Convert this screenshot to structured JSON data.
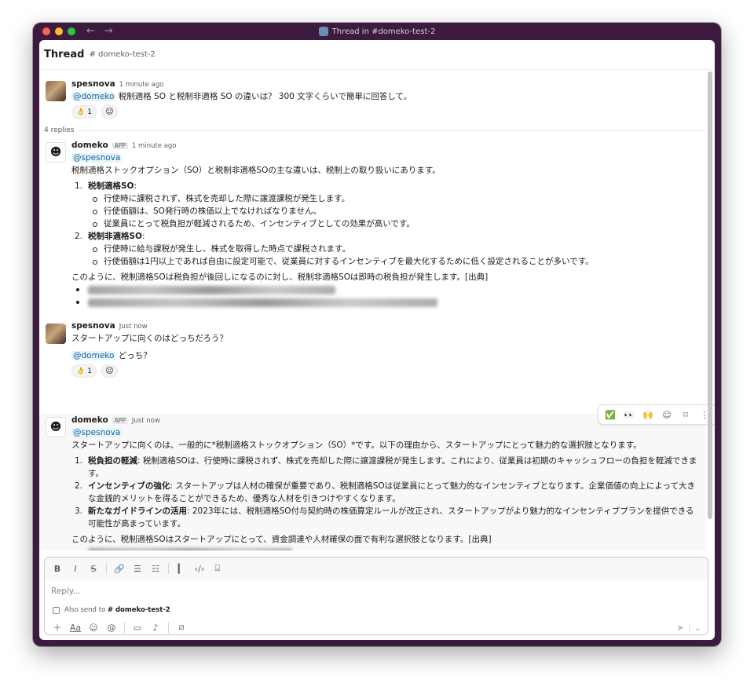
{
  "window": {
    "title": "Thread in #domeko-test-2",
    "back": "←",
    "forward": "→"
  },
  "header": {
    "title": "Thread",
    "channel": "# domeko-test-2"
  },
  "messages": [
    {
      "author": "spesnova",
      "time": "1 minute ago",
      "avatar": "photo-avatar",
      "mention": "@domeko",
      "text": " 税制適格 SO と税制非適格 SO の違いは？ 300 文字くらいで簡単に回答して。",
      "reactions": [
        {
          "emoji": "👌",
          "count": "1"
        }
      ]
    },
    {
      "author": "domeko",
      "badge": "APP",
      "time": "1 minute ago",
      "mention": "@spesnova",
      "intro": "税制適格ストックオプション（SO）と税制非適格SOの主な違いは、税制上の取り扱いにあります。",
      "items": [
        {
          "num": "1.",
          "title": "税制適格SO",
          "suffix": ":",
          "subs": [
            "行使時に課税されず、株式を売却した際に譲渡課税が発生します。",
            "行使価額は、SO発行時の株価以上でなければなりません。",
            "従業員にとって税負担が軽減されるため、インセンティブとしての効果が高いです。"
          ]
        },
        {
          "num": "2.",
          "title": "税制非適格SO",
          "suffix": ":",
          "subs": [
            "行使時に給与課税が発生し、株式を取得した時点で課税されます。",
            "行使価額は1円以上であれば自由に設定可能で、従業員に対するインセンティブを最大化するために低く設定されることが多いです。"
          ]
        }
      ],
      "conclusion": "このように、税制適格SOは税負担が後回しになるのに対し、税制非適格SOは即時の税負担が発生します。[出典]"
    },
    {
      "author": "spesnova",
      "time": "Just now",
      "line1": "スタートアップに向くのはどっちだろう？",
      "mention": "@domeko",
      "line2": " どっち？",
      "reactions": [
        {
          "emoji": "👌",
          "count": "1"
        }
      ]
    },
    {
      "author": "domeko",
      "badge": "APP",
      "time": "Just now",
      "mention": "@spesnova",
      "intro": "スタートアップに向くのは、一般的に*税制適格ストックオプション（SO）*です。以下の理由から、スタートアップにとって魅力的な選択肢となります。",
      "items": [
        {
          "num": "1.",
          "title": "税負担の軽減",
          "text": ": 税制適格SOは、行使時に課税されず、株式を売却した際に譲渡課税が発生します。これにより、従業員は初期のキャッシュフローの負担を軽減できます。"
        },
        {
          "num": "2.",
          "title": "インセンティブの強化",
          "text": ": スタートアップは人材の確保が重要であり、税制適格SOは従業員にとって魅力的なインセンティブとなります。企業価値の向上によって大きな金銭的メリットを得ることができるため、優秀な人材を引きつけやすくなります。"
        },
        {
          "num": "3.",
          "title": "新たなガイドラインの活用",
          "text": ": 2023年には、税制適格SO付与契約時の株価算定ルールが改正され、スタートアップがより魅力的なインセンティブプランを提供できる可能性が高まっています。"
        }
      ],
      "conclusion": "このように、税制適格SOはスタートアップにとって、資金調達や人材確保の面で有利な選択肢となります。[出典]"
    }
  ],
  "replies_count": "4 replies",
  "hover_actions": [
    "✅",
    "👀",
    "🙌",
    "add-reaction-icon",
    "bookmark-icon",
    "more-icon"
  ],
  "composer": {
    "placeholder": "Reply...",
    "also_send_prefix": "Also send to ",
    "also_send_channel": "# domeko-test-2",
    "format_buttons": [
      "bold-icon",
      "italic-icon",
      "strikethrough-icon",
      "link-icon",
      "ordered-list-icon",
      "bulleted-list-icon",
      "blockquote-icon",
      "code-icon",
      "code-block-icon"
    ],
    "bottom_buttons": [
      "plus-icon",
      "text-format-icon",
      "emoji-icon",
      "mention-icon",
      "video-icon",
      "microphone-icon",
      "slash-command-icon"
    ],
    "text_format_label": "Aa"
  },
  "colors": {
    "sidebar": "#3d1a3f",
    "mention_bg": "#e8f5fa",
    "mention_fg": "#1264a3"
  }
}
